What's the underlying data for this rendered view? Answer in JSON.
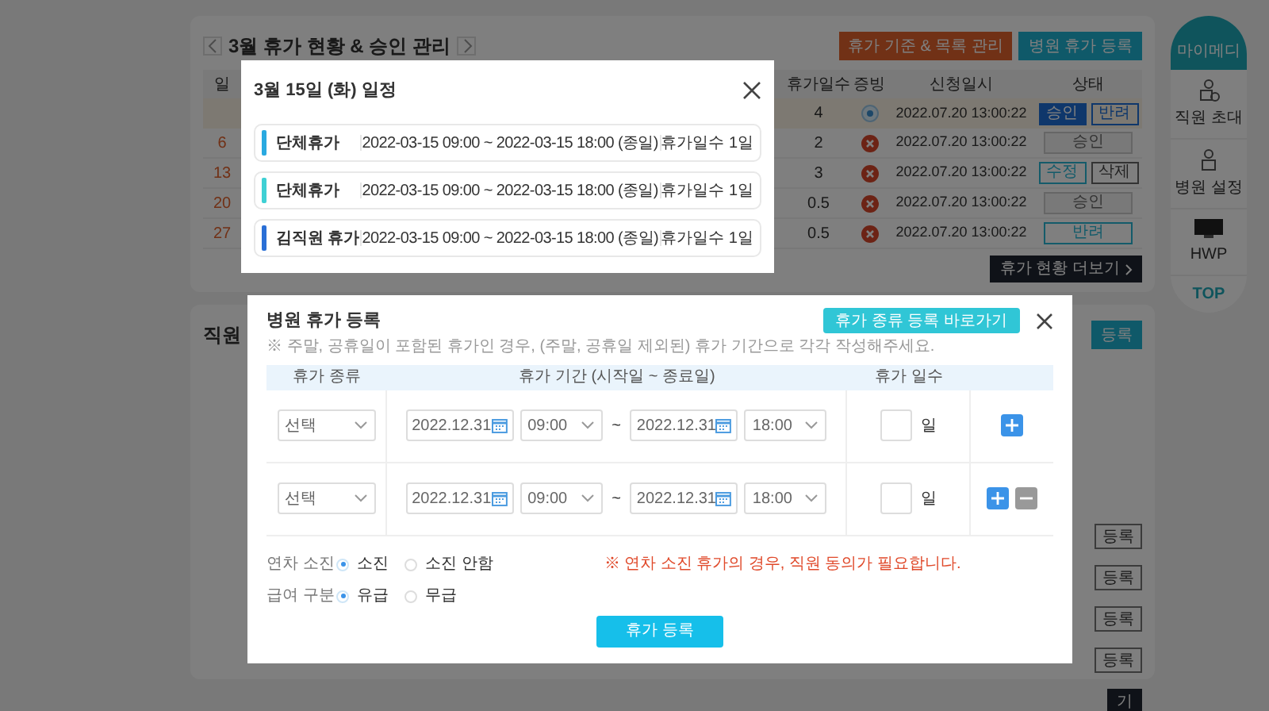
{
  "leave_panel": {
    "title": "3월 휴가 현황 & 승인 관리",
    "buttons": [
      {
        "label": "휴가 기준 & 목록 관리",
        "kind": "orange"
      },
      {
        "label": "병원 휴가 등록",
        "kind": "teal"
      }
    ],
    "columns": [
      "일",
      "휴가일수",
      "증빙",
      "신청일시",
      "상태"
    ],
    "rows": [
      {
        "days": "4",
        "kind": "attached",
        "applied": "2022.07.20 13:00:22",
        "selected": true,
        "actions": [
          {
            "label": "승인",
            "kind": "primary"
          },
          {
            "label": "반려",
            "kind": "outline"
          }
        ]
      },
      {
        "day": "6",
        "days": "2",
        "kind": "missing",
        "applied": "2022.07.20 13:00:22",
        "selected": false,
        "actions": [
          {
            "label": "승인",
            "kind": "disabled"
          }
        ]
      },
      {
        "day": "13",
        "days": "3",
        "kind": "missing",
        "applied": "2022.07.20 13:00:22",
        "selected": false,
        "actions": [
          {
            "label": "수정",
            "kind": "teal"
          },
          {
            "label": "삭제",
            "kind": "gray"
          }
        ]
      },
      {
        "day": "20",
        "days": "0.5",
        "kind": "missing",
        "applied": "2022.07.20 13:00:22",
        "selected": false,
        "actions": [
          {
            "label": "승인",
            "kind": "disabled"
          }
        ]
      },
      {
        "day": "27",
        "days": "0.5",
        "kind": "missing",
        "applied": "2022.07.20 13:00:22",
        "selected": false,
        "actions": [
          {
            "label": "반려",
            "kind": "teal-wide"
          }
        ]
      }
    ],
    "more_button": "휴가 현황 더보기"
  },
  "staff_panel": {
    "title": "직원",
    "button": "등록",
    "row_buttons": [
      "등록",
      "등록",
      "등록",
      "등록"
    ],
    "more_button": "기"
  },
  "quick_menu": {
    "header": "마이메디",
    "items": [
      {
        "label": "직원 초대",
        "kind": "person-file"
      },
      {
        "label": "병원 설정",
        "kind": "person"
      },
      {
        "label": "HWP",
        "kind": "hwp"
      }
    ],
    "top": "TOP"
  },
  "schedule_modal": {
    "title": "3월 15일 (화) 일정",
    "items": [
      {
        "name": "단체휴가",
        "range": "2022-03-15 09:00 ~ 2022-03-15 18:00 (종일)",
        "days": "휴가일수 1일",
        "color": "#29a9e0"
      },
      {
        "name": "단체휴가",
        "range": "2022-03-15 09:00 ~ 2022-03-15 18:00 (종일)",
        "days": "휴가일수 1일",
        "color": "#3fd0d4"
      },
      {
        "name": "김직원 휴가",
        "range": "2022-03-15 09:00 ~ 2022-03-15 18:00 (종일)",
        "days": "휴가일수 1일",
        "color": "#2a6fd6"
      }
    ]
  },
  "register_modal": {
    "title": "병원 휴가 등록",
    "note": "※ 주말, 공휴일이 포함된 휴가인 경우, (주말, 공휴일 제외된) 휴가 기간으로 각각 작성해주세요.",
    "shortcut_button": "휴가 종류 등록 바로가기",
    "columns": [
      "휴가 종류",
      "휴가 기간 (시작일 ~ 종료일)",
      "휴가 일수"
    ],
    "rows": [
      {
        "type": "선택",
        "start_date": "2022.12.31",
        "start_time": "09:00",
        "separator": "~",
        "end_date": "2022.12.31",
        "end_time": "18:00",
        "unit": "일",
        "removable": false
      },
      {
        "type": "선택",
        "start_date": "2022.12.31",
        "start_time": "09:00",
        "separator": "~",
        "end_date": "2022.12.31",
        "end_time": "18:00",
        "unit": "일",
        "removable": true
      }
    ],
    "options": [
      {
        "label": "연차 소진",
        "choices": [
          {
            "label": "소진",
            "selected": true
          },
          {
            "label": "소진 안함",
            "selected": false
          }
        ],
        "warning": "※ 연차 소진 휴가의 경우, 직원 동의가 필요합니다."
      },
      {
        "label": "급여 구분",
        "choices": [
          {
            "label": "유급",
            "selected": true
          },
          {
            "label": "무급",
            "selected": false
          }
        ]
      }
    ],
    "submit_button": "휴가 등록"
  }
}
